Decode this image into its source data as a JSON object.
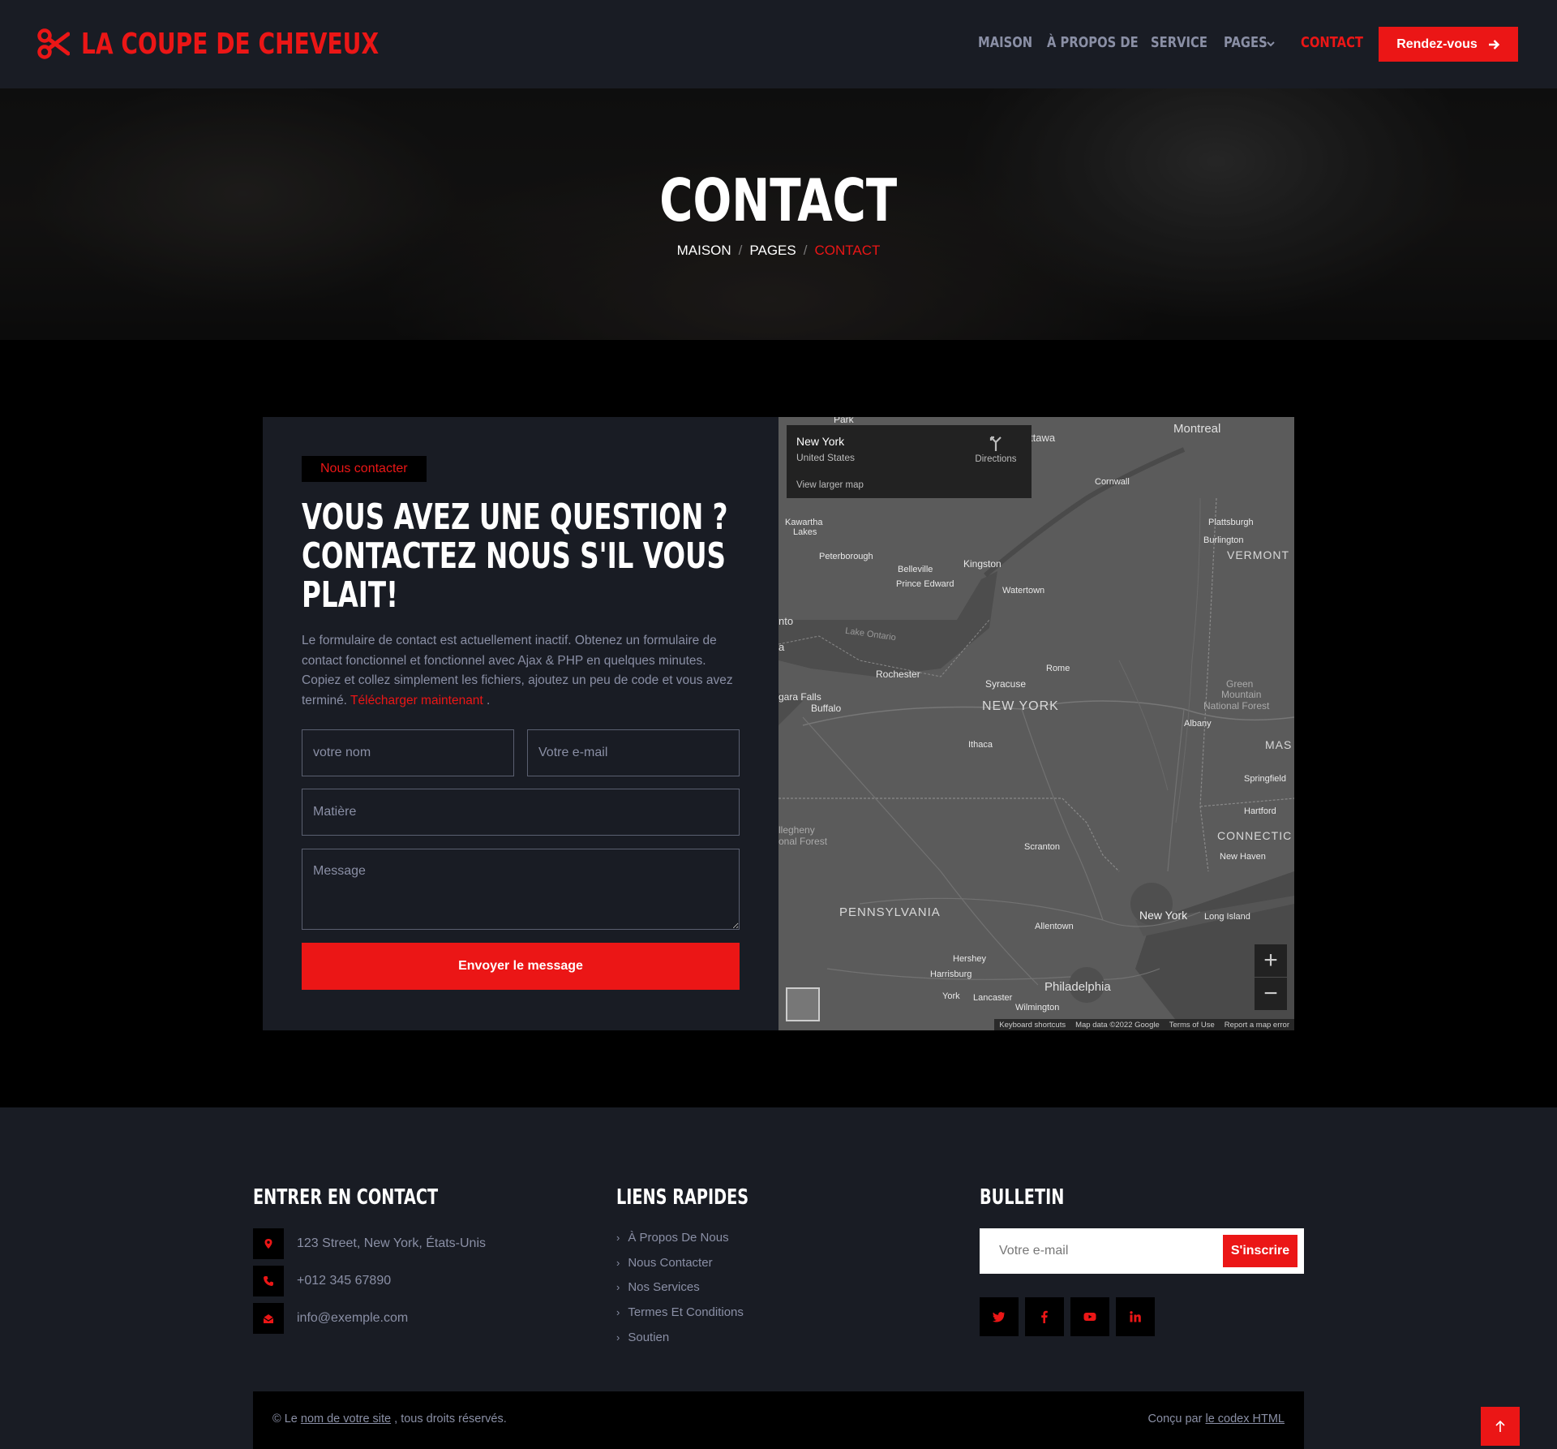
{
  "brand": {
    "name": "LA COUPE DE CHEVEUX",
    "icon": "scissors-icon",
    "color": "#eb1616"
  },
  "nav": {
    "items": [
      {
        "label": "MAISON"
      },
      {
        "label": "À PROPOS DE"
      },
      {
        "label": "SERVICE"
      },
      {
        "label": "PAGES"
      },
      {
        "label": "CONTACT"
      }
    ],
    "cta_label": "Rendez-vous"
  },
  "hero": {
    "title": "CONTACT",
    "breadcrumb": [
      "MAISON",
      "PAGES",
      "CONTACT"
    ]
  },
  "contact": {
    "badge": "Nous contacter",
    "heading_lines": [
      "VOUS AVEZ UNE QUESTION ?",
      "CONTACTEZ NOUS S'IL VOUS",
      "PLAIT!"
    ],
    "paragraph": "Le formulaire de contact est actuellement inactif. Obtenez un formulaire de contact fonctionnel et fonctionnel avec Ajax & PHP en quelques minutes. Copiez et collez simplement les fichiers, ajoutez un peu de code et vous avez terminé.",
    "paragraph_link": "Télécharger maintenant",
    "paragraph_end": " .",
    "name_placeholder": "votre nom",
    "email_placeholder": "Votre e-mail",
    "subject_placeholder": "Matière",
    "message_placeholder": "Message",
    "submit_label": "Envoyer le message"
  },
  "map": {
    "card_title": "New York",
    "card_subtitle": "United States",
    "card_link": "View larger map",
    "directions_label": "Directions",
    "labels": {
      "park": "Park",
      "ottawa": "ttawa",
      "montreal": "Montreal",
      "cornwall": "Cornwall",
      "plattsburgh": "Plattsburgh",
      "burlington": "Burlington",
      "vermont": "VERMONT",
      "kawartha": "Kawartha",
      "lakes": "Lakes",
      "peterborough": "Peterborough",
      "belleville": "Belleville",
      "prince_edward": "Prince Edward",
      "kingston": "Kingston",
      "watertown": "Watertown",
      "toronto": "nto",
      "lake_ontario": "Lake Ontario",
      "a": "a",
      "rochester": "Rochester",
      "rome": "Rome",
      "syracuse": "Syracuse",
      "new_york_state": "NEW YORK",
      "green_mountain_1": "Green",
      "green_mountain_2": "Mountain",
      "green_mountain_3": "National Forest",
      "niagara_falls": "gara Falls",
      "buffalo": "Buffalo",
      "albany": "Albany",
      "ithaca": "Ithaca",
      "mass": "MAS",
      "springfield": "Springfield",
      "allegheny_1": "llegheny",
      "allegheny_2": "onal Forest",
      "hartford": "Hartford",
      "scranton": "Scranton",
      "connecticut": "CONNECTIC",
      "new_haven": "New Haven",
      "pennsylvania": "PENNSYLVANIA",
      "new_york_city": "New York",
      "long_island": "Long Island",
      "allentown": "Allentown",
      "hershey": "Hershey",
      "harrisburg": "Harrisburg",
      "philadelphia": "Philadelphia",
      "york": "York",
      "lancaster": "Lancaster",
      "wilmington": "Wilmington"
    },
    "zoom_in": "+",
    "zoom_out": "−",
    "footer": [
      "Keyboard shortcuts",
      "Map data ©2022 Google",
      "Terms of Use",
      "Report a map error"
    ]
  },
  "footer": {
    "contact_title": "ENTRER EN CONTACT",
    "address": "123 Street, New York, États-Unis",
    "phone": "+012 345 67890",
    "email": "info@exemple.com",
    "links_title": "LIENS RAPIDES",
    "links": [
      "À Propos De Nous",
      "Nous Contacter",
      "Nos Services",
      "Termes Et Conditions",
      "Soutien"
    ],
    "newsletter_title": "BULLETIN",
    "newsletter_placeholder": "Votre e-mail",
    "newsletter_button": "S'inscrire",
    "social": [
      "twitter-icon",
      "facebook-icon",
      "youtube-icon",
      "linkedin-icon"
    ],
    "copyright_prefix": "© Le",
    "copyright_link": "nom de votre site",
    "copyright_suffix": ", tous droits réservés.",
    "designed_prefix": "Conçu par",
    "designed_link": "le codex HTML"
  }
}
